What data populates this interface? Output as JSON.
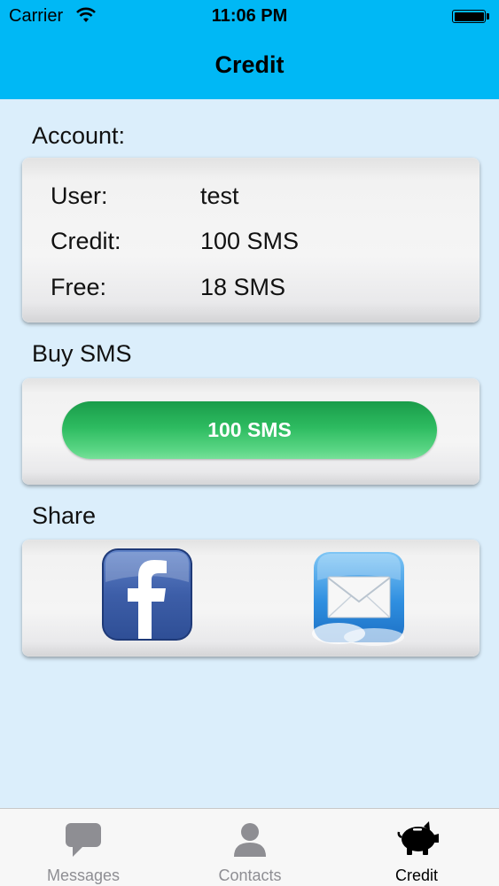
{
  "status_bar": {
    "carrier": "Carrier",
    "time": "11:06 PM"
  },
  "nav": {
    "title": "Credit"
  },
  "account": {
    "heading": "Account:",
    "rows": [
      {
        "label": "User:",
        "value": "test"
      },
      {
        "label": "Credit:",
        "value": "100 SMS"
      },
      {
        "label": "Free:",
        "value": "18 SMS"
      }
    ]
  },
  "buy": {
    "heading": "Buy SMS",
    "button_label": "100 SMS"
  },
  "share": {
    "heading": "Share",
    "icons": [
      "facebook-icon",
      "mail-icon"
    ]
  },
  "tabs": [
    {
      "label": "Messages",
      "icon": "speech-bubble-icon",
      "active": false
    },
    {
      "label": "Contacts",
      "icon": "person-icon",
      "active": false
    },
    {
      "label": "Credit",
      "icon": "piggy-bank-icon",
      "active": true
    }
  ],
  "colors": {
    "nav_bar": "#00b8f5",
    "background": "#dbeefb",
    "buy_button": "#2dbb60",
    "tab_active": "#000000",
    "tab_inactive": "#8e8e93"
  }
}
